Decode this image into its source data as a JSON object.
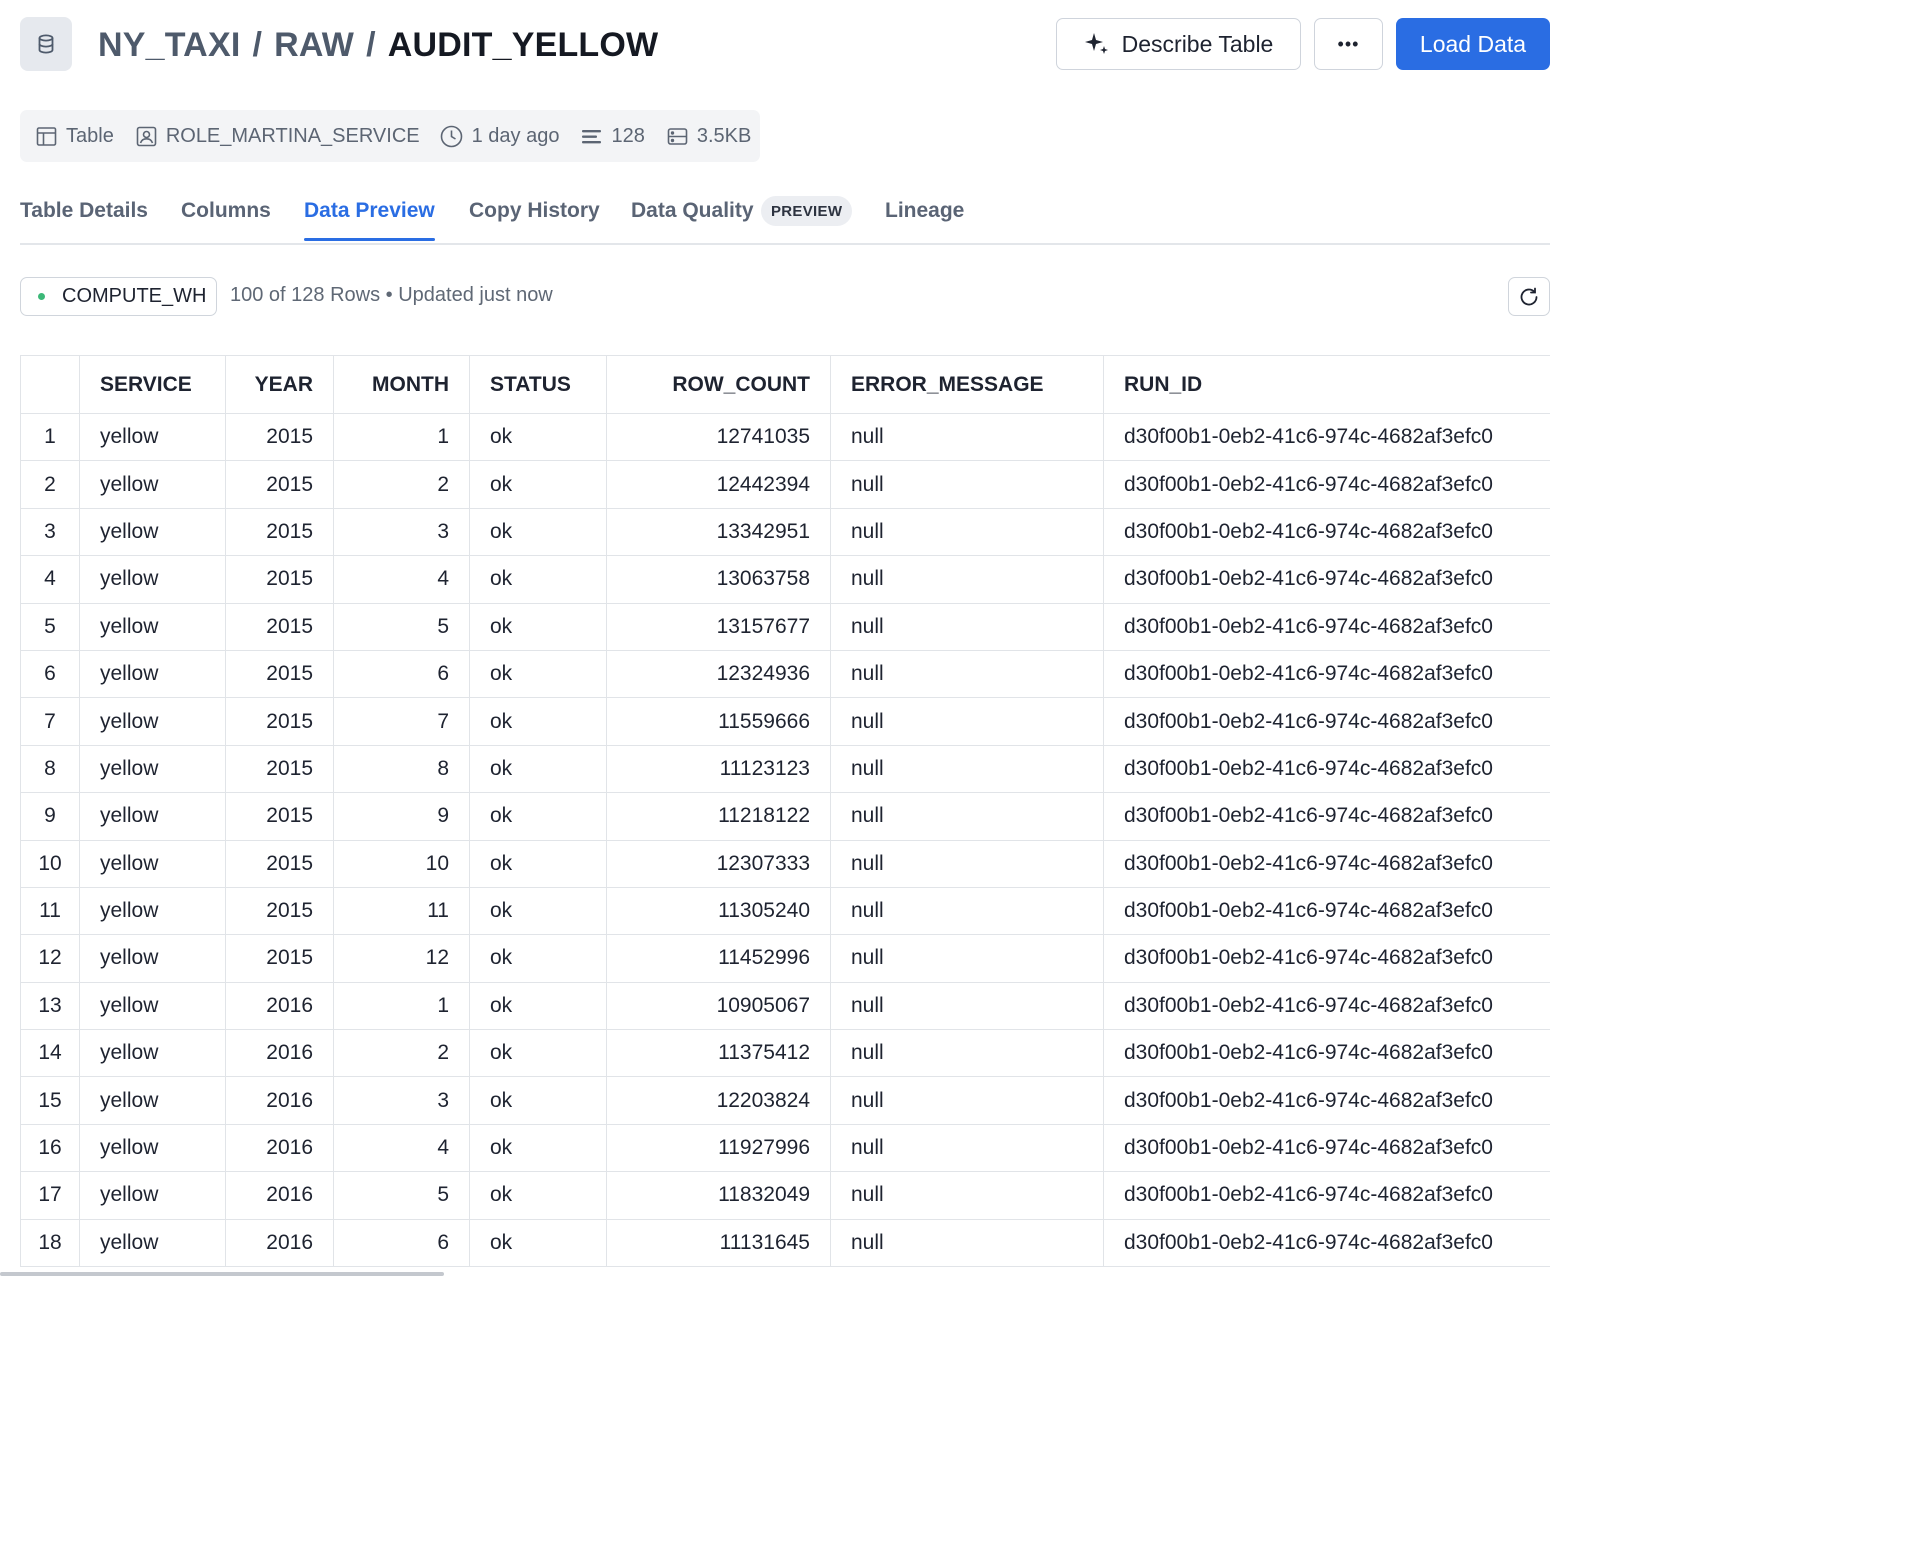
{
  "header": {
    "breadcrumb": [
      "NY_TAXI",
      "RAW"
    ],
    "table_name": "AUDIT_YELLOW",
    "describe_label": "Describe Table",
    "more_label": "•••",
    "load_label": "Load Data",
    "icon": "database-icon"
  },
  "meta": {
    "type_label": "Table",
    "owner": "ROLE_MARTINA_SERVICE",
    "updated": "1 day ago",
    "row_count": "128",
    "size": "3.5KB"
  },
  "tabs": [
    {
      "label": "Table Details",
      "active": false
    },
    {
      "label": "Columns",
      "active": false
    },
    {
      "label": "Data Preview",
      "active": true
    },
    {
      "label": "Copy History",
      "active": false
    },
    {
      "label": "Data Quality",
      "active": false
    },
    {
      "label": "Lineage",
      "active": false
    }
  ],
  "preview_badge": "PREVIEW",
  "toolbar": {
    "warehouse": "COMPUTE_WH",
    "rows_info": "100 of 128 Rows • Updated just now"
  },
  "colors": {
    "accent": "#2a6de3",
    "status_dot": "#3cb878"
  },
  "table": {
    "columns": [
      "SERVICE",
      "YEAR",
      "MONTH",
      "STATUS",
      "ROW_COUNT",
      "ERROR_MESSAGE",
      "RUN_ID"
    ],
    "rows": [
      [
        "1",
        "yellow",
        "2015",
        "1",
        "ok",
        "12741035",
        "null",
        "d30f00b1-0eb2-41c6-974c-4682af3efc0"
      ],
      [
        "2",
        "yellow",
        "2015",
        "2",
        "ok",
        "12442394",
        "null",
        "d30f00b1-0eb2-41c6-974c-4682af3efc0"
      ],
      [
        "3",
        "yellow",
        "2015",
        "3",
        "ok",
        "13342951",
        "null",
        "d30f00b1-0eb2-41c6-974c-4682af3efc0"
      ],
      [
        "4",
        "yellow",
        "2015",
        "4",
        "ok",
        "13063758",
        "null",
        "d30f00b1-0eb2-41c6-974c-4682af3efc0"
      ],
      [
        "5",
        "yellow",
        "2015",
        "5",
        "ok",
        "13157677",
        "null",
        "d30f00b1-0eb2-41c6-974c-4682af3efc0"
      ],
      [
        "6",
        "yellow",
        "2015",
        "6",
        "ok",
        "12324936",
        "null",
        "d30f00b1-0eb2-41c6-974c-4682af3efc0"
      ],
      [
        "7",
        "yellow",
        "2015",
        "7",
        "ok",
        "11559666",
        "null",
        "d30f00b1-0eb2-41c6-974c-4682af3efc0"
      ],
      [
        "8",
        "yellow",
        "2015",
        "8",
        "ok",
        "11123123",
        "null",
        "d30f00b1-0eb2-41c6-974c-4682af3efc0"
      ],
      [
        "9",
        "yellow",
        "2015",
        "9",
        "ok",
        "11218122",
        "null",
        "d30f00b1-0eb2-41c6-974c-4682af3efc0"
      ],
      [
        "10",
        "yellow",
        "2015",
        "10",
        "ok",
        "12307333",
        "null",
        "d30f00b1-0eb2-41c6-974c-4682af3efc0"
      ],
      [
        "11",
        "yellow",
        "2015",
        "11",
        "ok",
        "11305240",
        "null",
        "d30f00b1-0eb2-41c6-974c-4682af3efc0"
      ],
      [
        "12",
        "yellow",
        "2015",
        "12",
        "ok",
        "11452996",
        "null",
        "d30f00b1-0eb2-41c6-974c-4682af3efc0"
      ],
      [
        "13",
        "yellow",
        "2016",
        "1",
        "ok",
        "10905067",
        "null",
        "d30f00b1-0eb2-41c6-974c-4682af3efc0"
      ],
      [
        "14",
        "yellow",
        "2016",
        "2",
        "ok",
        "11375412",
        "null",
        "d30f00b1-0eb2-41c6-974c-4682af3efc0"
      ],
      [
        "15",
        "yellow",
        "2016",
        "3",
        "ok",
        "12203824",
        "null",
        "d30f00b1-0eb2-41c6-974c-4682af3efc0"
      ],
      [
        "16",
        "yellow",
        "2016",
        "4",
        "ok",
        "11927996",
        "null",
        "d30f00b1-0eb2-41c6-974c-4682af3efc0"
      ],
      [
        "17",
        "yellow",
        "2016",
        "5",
        "ok",
        "11832049",
        "null",
        "d30f00b1-0eb2-41c6-974c-4682af3efc0"
      ],
      [
        "18",
        "yellow",
        "2016",
        "6",
        "ok",
        "11131645",
        "null",
        "d30f00b1-0eb2-41c6-974c-4682af3efc0"
      ]
    ]
  }
}
